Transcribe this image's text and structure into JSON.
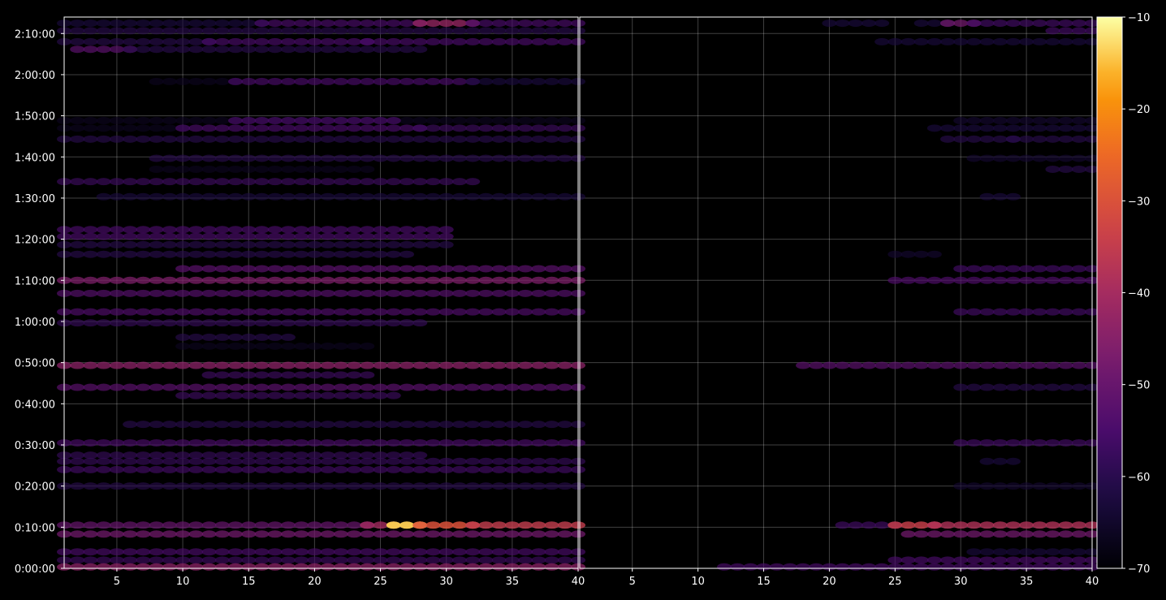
{
  "chart_data": {
    "type": "heatmap",
    "title": "",
    "colormap": "inferno",
    "background": "#000000",
    "grid": true,
    "panels": [
      {
        "name": "",
        "xlim": [
          1,
          40
        ],
        "x_ticks": [
          5,
          10,
          15,
          20,
          25,
          30,
          35,
          40
        ]
      },
      {
        "name": "",
        "xlim": [
          1,
          40
        ],
        "x_ticks": [
          5,
          10,
          15,
          20,
          25,
          30,
          35,
          40
        ]
      }
    ],
    "y_axis": {
      "lim_seconds": [
        0,
        8040
      ],
      "ticks": [
        {
          "label": "0:00:00",
          "seconds": 0
        },
        {
          "label": "0:10:00",
          "seconds": 600
        },
        {
          "label": "0:20:00",
          "seconds": 1200
        },
        {
          "label": "0:30:00",
          "seconds": 1800
        },
        {
          "label": "0:40:00",
          "seconds": 2400
        },
        {
          "label": "0:50:00",
          "seconds": 3000
        },
        {
          "label": "1:00:00",
          "seconds": 3600
        },
        {
          "label": "1:10:00",
          "seconds": 4200
        },
        {
          "label": "1:20:00",
          "seconds": 4800
        },
        {
          "label": "1:30:00",
          "seconds": 5400
        },
        {
          "label": "1:40:00",
          "seconds": 6000
        },
        {
          "label": "1:50:00",
          "seconds": 6600
        },
        {
          "label": "2:00:00",
          "seconds": 7200
        },
        {
          "label": "2:10:00",
          "seconds": 7800
        }
      ]
    },
    "colorbar": {
      "range": [
        -70,
        -10
      ],
      "ticks": [
        -10,
        -20,
        -30,
        -40,
        -50,
        -60,
        -70
      ],
      "tick_labels": [
        "−10",
        "−20",
        "−30",
        "−40",
        "−50",
        "−60",
        "−70"
      ]
    },
    "rows": [
      {
        "t": 7950,
        "p1": [
          [
            1,
            16,
            -62
          ],
          [
            16,
            28,
            -55
          ],
          [
            28,
            32,
            -42
          ],
          [
            32,
            40,
            -55
          ]
        ],
        "p2": [
          [
            20,
            24,
            -62
          ],
          [
            27,
            29,
            -62
          ],
          [
            29,
            31,
            -48
          ],
          [
            31,
            40,
            -56
          ]
        ]
      },
      {
        "t": 7840,
        "p1": [
          [
            1,
            40,
            -60
          ]
        ],
        "p2": [
          [
            37,
            40,
            -56
          ]
        ]
      },
      {
        "t": 7680,
        "p1": [
          [
            1,
            12,
            -60
          ],
          [
            12,
            24,
            -55
          ],
          [
            24,
            40,
            -55
          ]
        ],
        "p2": [
          [
            24,
            40,
            -62
          ]
        ]
      },
      {
        "t": 7570,
        "p1": [
          [
            2,
            6,
            -52
          ],
          [
            6,
            28,
            -60
          ]
        ],
        "p2": []
      },
      {
        "t": 7100,
        "p1": [
          [
            8,
            14,
            -66
          ],
          [
            14,
            32,
            -55
          ],
          [
            32,
            40,
            -62
          ]
        ],
        "p2": []
      },
      {
        "t": 6530,
        "p1": [
          [
            1,
            40,
            -66
          ],
          [
            14,
            26,
            -55
          ]
        ],
        "p2": [
          [
            30,
            40,
            -64
          ]
        ]
      },
      {
        "t": 6420,
        "p1": [
          [
            1,
            10,
            -66
          ],
          [
            10,
            28,
            -55
          ],
          [
            28,
            40,
            -57
          ]
        ],
        "p2": [
          [
            28,
            40,
            -62
          ]
        ]
      },
      {
        "t": 6260,
        "p1": [
          [
            1,
            40,
            -60
          ]
        ],
        "p2": [
          [
            29,
            34,
            -60
          ],
          [
            34,
            40,
            -60
          ]
        ]
      },
      {
        "t": 5980,
        "p1": [
          [
            8,
            40,
            -60
          ]
        ],
        "p2": [
          [
            31,
            40,
            -64
          ]
        ]
      },
      {
        "t": 5820,
        "p1": [
          [
            8,
            24,
            -66
          ]
        ],
        "p2": [
          [
            37,
            40,
            -60
          ]
        ]
      },
      {
        "t": 5640,
        "p1": [
          [
            1,
            32,
            -57
          ]
        ],
        "p2": []
      },
      {
        "t": 5420,
        "p1": [
          [
            4,
            40,
            -62
          ]
        ],
        "p2": [
          [
            32,
            34,
            -62
          ]
        ]
      },
      {
        "t": 4940,
        "p1": [
          [
            1,
            30,
            -55
          ]
        ],
        "p2": []
      },
      {
        "t": 4840,
        "p1": [
          [
            1,
            30,
            -55
          ]
        ],
        "p2": []
      },
      {
        "t": 4720,
        "p1": [
          [
            1,
            30,
            -60
          ]
        ],
        "p2": []
      },
      {
        "t": 4580,
        "p1": [
          [
            1,
            27,
            -60
          ]
        ],
        "p2": [
          [
            25,
            28,
            -64
          ]
        ]
      },
      {
        "t": 4370,
        "p1": [
          [
            10,
            40,
            -52
          ]
        ],
        "p2": [
          [
            30,
            40,
            -56
          ]
        ]
      },
      {
        "t": 4200,
        "p1": [
          [
            1,
            40,
            -46
          ]
        ],
        "p2": [
          [
            25,
            40,
            -54
          ]
        ]
      },
      {
        "t": 4010,
        "p1": [
          [
            1,
            40,
            -53
          ]
        ],
        "p2": []
      },
      {
        "t": 3740,
        "p1": [
          [
            1,
            40,
            -54
          ]
        ],
        "p2": [
          [
            30,
            40,
            -56
          ]
        ]
      },
      {
        "t": 3580,
        "p1": [
          [
            1,
            28,
            -58
          ]
        ],
        "p2": []
      },
      {
        "t": 3370,
        "p1": [
          [
            10,
            18,
            -60
          ]
        ],
        "p2": []
      },
      {
        "t": 3240,
        "p1": [
          [
            10,
            24,
            -66
          ]
        ],
        "p2": []
      },
      {
        "t": 2960,
        "p1": [
          [
            1,
            40,
            -44
          ]
        ],
        "p2": [
          [
            18,
            40,
            -52
          ]
        ]
      },
      {
        "t": 2820,
        "p1": [
          [
            12,
            24,
            -57
          ]
        ],
        "p2": []
      },
      {
        "t": 2640,
        "p1": [
          [
            1,
            40,
            -52
          ]
        ],
        "p2": [
          [
            30,
            40,
            -60
          ]
        ]
      },
      {
        "t": 2520,
        "p1": [
          [
            10,
            26,
            -57
          ]
        ],
        "p2": []
      },
      {
        "t": 2100,
        "p1": [
          [
            6,
            40,
            -60
          ]
        ],
        "p2": []
      },
      {
        "t": 1830,
        "p1": [
          [
            1,
            40,
            -55
          ]
        ],
        "p2": [
          [
            30,
            40,
            -56
          ]
        ]
      },
      {
        "t": 1650,
        "p1": [
          [
            1,
            28,
            -58
          ]
        ],
        "p2": []
      },
      {
        "t": 1560,
        "p1": [
          [
            1,
            40,
            -58
          ]
        ],
        "p2": [
          [
            32,
            34,
            -62
          ]
        ]
      },
      {
        "t": 1440,
        "p1": [
          [
            1,
            40,
            -56
          ]
        ],
        "p2": []
      },
      {
        "t": 1200,
        "p1": [
          [
            1,
            40,
            -60
          ]
        ],
        "p2": [
          [
            30,
            40,
            -64
          ]
        ]
      },
      {
        "t": 630,
        "p1": [
          [
            1,
            24,
            -50
          ],
          [
            24,
            26,
            -40
          ],
          [
            26,
            28,
            -14
          ],
          [
            28,
            32,
            -30
          ],
          [
            32,
            40,
            -35
          ]
        ],
        "p2": [
          [
            21,
            25,
            -56
          ],
          [
            25,
            28,
            -34
          ],
          [
            28,
            40,
            -38
          ]
        ]
      },
      {
        "t": 500,
        "p1": [
          [
            1,
            40,
            -48
          ]
        ],
        "p2": [
          [
            26,
            40,
            -48
          ]
        ]
      },
      {
        "t": 240,
        "p1": [
          [
            1,
            40,
            -55
          ]
        ],
        "p2": [
          [
            31,
            40,
            -62
          ]
        ]
      },
      {
        "t": 120,
        "p1": [
          [
            1,
            40,
            -57
          ]
        ],
        "p2": [
          [
            25,
            40,
            -55
          ]
        ]
      },
      {
        "t": 20,
        "p1": [
          [
            1,
            40,
            -44
          ]
        ],
        "p2": [
          [
            12,
            40,
            -55
          ]
        ]
      }
    ]
  }
}
